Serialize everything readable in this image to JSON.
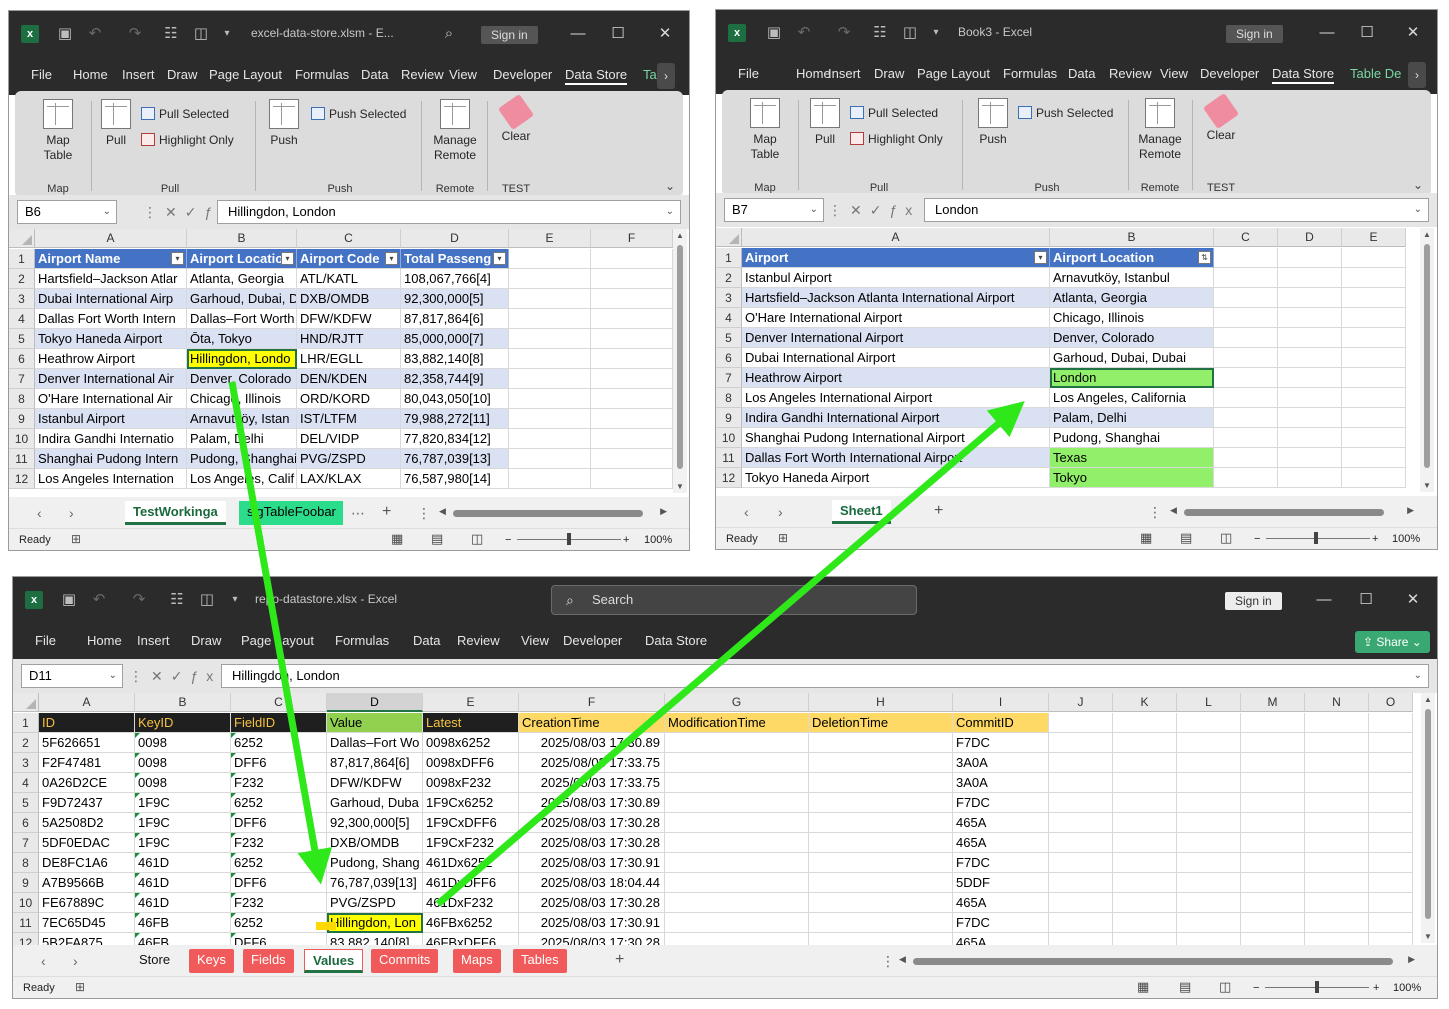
{
  "win1": {
    "title": "excel-data-store.xlsm  -  E...",
    "signin": "Sign in",
    "menus": [
      "File",
      "Home",
      "Insert",
      "Draw",
      "Page Layout",
      "Formulas",
      "Data",
      "Review",
      "View",
      "Developer",
      "Data Store",
      "Ta"
    ],
    "namebox": "B6",
    "formula": "Hillingdon, London",
    "cols": [
      "A",
      "B",
      "C",
      "D",
      "E",
      "F"
    ],
    "rows": [
      "1",
      "2",
      "3",
      "4",
      "5",
      "6",
      "7",
      "8",
      "9",
      "10",
      "11",
      "12"
    ],
    "header": [
      "Airport Name",
      "Airport Locatio",
      "Airport Code",
      "Total Passeng"
    ],
    "data": [
      [
        "Hartsfield–Jackson Atlar",
        "Atlanta, Georgia",
        "ATL/KATL",
        "108,067,766[4]"
      ],
      [
        "Dubai International Airp",
        "Garhoud, Dubai, D",
        "DXB/OMDB",
        "92,300,000[5]"
      ],
      [
        "Dallas Fort Worth Intern",
        "Dallas–Fort Worth",
        "DFW/KDFW",
        "87,817,864[6]"
      ],
      [
        "Tokyo Haneda Airport",
        "Ōta, Tokyo",
        "HND/RJTT",
        "85,000,000[7]"
      ],
      [
        "Heathrow Airport",
        "Hillingdon, Londo",
        "LHR/EGLL",
        "83,882,140[8]"
      ],
      [
        "Denver International Air",
        "Denver, Colorado",
        "DEN/KDEN",
        "82,358,744[9]"
      ],
      [
        "O'Hare International Air",
        "Chicago, Illinois",
        "ORD/KORD",
        "80,043,050[10]"
      ],
      [
        "Istanbul Airport",
        "Arnavutköy, Istan",
        "IST/LTFM",
        "79,988,272[11]"
      ],
      [
        "Indira Gandhi Internatio",
        "Palam, Delhi",
        "DEL/VIDP",
        "77,820,834[12]"
      ],
      [
        "Shanghai Pudong Intern",
        "Pudong, Shanghai",
        "PVG/ZSPD",
        "76,787,039[13]"
      ],
      [
        "Los Angeles Internation",
        "Los Angeles, Calif",
        "LAX/KLAX",
        "76,587,980[14]"
      ]
    ],
    "tabs": [
      "TestWorkinga",
      "sigTableFoobar"
    ],
    "status": "Ready",
    "zoom": "100%"
  },
  "win2": {
    "title": "Book3  -  Excel",
    "signin": "Sign in",
    "menus": [
      "File",
      "Home",
      "Insert",
      "Draw",
      "Page Layout",
      "Formulas",
      "Data",
      "Review",
      "View",
      "Developer",
      "Data Store",
      "Table De"
    ],
    "namebox": "B7",
    "formula": "London",
    "cols": [
      "A",
      "B",
      "C",
      "D",
      "E"
    ],
    "rows": [
      "1",
      "2",
      "3",
      "4",
      "5",
      "6",
      "7",
      "8",
      "9",
      "10",
      "11",
      "12"
    ],
    "header": [
      "Airport",
      "Airport Location"
    ],
    "data": [
      [
        "Istanbul Airport",
        "Arnavutköy, Istanbul"
      ],
      [
        "Hartsfield–Jackson Atlanta International Airport",
        "Atlanta, Georgia"
      ],
      [
        "O'Hare International Airport",
        "Chicago, Illinois"
      ],
      [
        "Denver International Airport",
        "Denver, Colorado"
      ],
      [
        "Dubai International Airport",
        "Garhoud, Dubai, Dubai"
      ],
      [
        "Heathrow Airport",
        "London"
      ],
      [
        "Los Angeles International Airport",
        "Los Angeles, California"
      ],
      [
        "Indira Gandhi International Airport",
        "Palam, Delhi"
      ],
      [
        "Shanghai Pudong International Airport",
        "Pudong, Shanghai"
      ],
      [
        "Dallas Fort Worth International Airport",
        "Texas"
      ],
      [
        "Tokyo Haneda Airport",
        "Tokyo"
      ]
    ],
    "tabs": [
      "Sheet1"
    ],
    "status": "Ready",
    "zoom": "100%"
  },
  "ribbon": {
    "map_table": "Map Table",
    "pull": "Pull",
    "pull_selected": "Pull Selected",
    "highlight_only": "Highlight Only",
    "push": "Push",
    "push_selected": "Push Selected",
    "manage_remote": "Manage Remote",
    "clear": "Clear",
    "groups": [
      "Map",
      "Pull",
      "Push",
      "Remote",
      "TEST"
    ]
  },
  "win3": {
    "title": "repo-datastore.xlsx  -  Excel",
    "search": "Search",
    "signin": "Sign in",
    "share": "Share",
    "menus": [
      "File",
      "Home",
      "Insert",
      "Draw",
      "Page Layout",
      "Formulas",
      "Data",
      "Review",
      "View",
      "Developer",
      "Data Store"
    ],
    "namebox": "D11",
    "formula": "Hillingdon, London",
    "cols": [
      "A",
      "B",
      "C",
      "D",
      "E",
      "F",
      "G",
      "H",
      "I",
      "J",
      "K",
      "L",
      "M",
      "N",
      "O"
    ],
    "rows": [
      "1",
      "2",
      "3",
      "4",
      "5",
      "6",
      "7",
      "8",
      "9",
      "10",
      "11",
      "12"
    ],
    "header": [
      "ID",
      "KeyID",
      "FieldID",
      "Value",
      "Latest",
      "CreationTime",
      "ModificationTime",
      "DeletionTime",
      "CommitID"
    ],
    "data": [
      [
        "5F626651",
        "0098",
        "6252",
        "Dallas–Fort Wo",
        "0098x6252",
        "2025/08/03 17:30.89",
        "",
        "",
        "F7DC"
      ],
      [
        "F2F47481",
        "0098",
        "DFF6",
        "87,817,864[6]",
        "0098xDFF6",
        "2025/08/03 17:33.75",
        "",
        "",
        "3A0A"
      ],
      [
        "0A26D2CE",
        "0098",
        "F232",
        "DFW/KDFW",
        "0098xF232",
        "2025/08/03 17:33.75",
        "",
        "",
        "3A0A"
      ],
      [
        "F9D72437",
        "1F9C",
        "6252",
        "Garhoud, Duba",
        "1F9Cx6252",
        "2025/08/03 17:30.89",
        "",
        "",
        "F7DC"
      ],
      [
        "5A2508D2",
        "1F9C",
        "DFF6",
        "92,300,000[5]",
        "1F9CxDFF6",
        "2025/08/03 17:30.28",
        "",
        "",
        "465A"
      ],
      [
        "5DF0EDAC",
        "1F9C",
        "F232",
        "DXB/OMDB",
        "1F9CxF232",
        "2025/08/03 17:30.28",
        "",
        "",
        "465A"
      ],
      [
        "DE8FC1A6",
        "461D",
        "6252",
        "Pudong, Shang",
        "461Dx6252",
        "2025/08/03 17:30.91",
        "",
        "",
        "F7DC"
      ],
      [
        "A7B9566B",
        "461D",
        "DFF6",
        "76,787,039[13]",
        "461DxDFF6",
        "2025/08/03 18:04.44",
        "",
        "",
        "5DDF"
      ],
      [
        "FE67889C",
        "461D",
        "F232",
        "PVG/ZSPD",
        "461DxF232",
        "2025/08/03 17:30.28",
        "",
        "",
        "465A"
      ],
      [
        "7EC65D45",
        "46FB",
        "6252",
        "Hillingdon, Lon",
        "46FBx6252",
        "2025/08/03 17:30.91",
        "",
        "",
        "F7DC"
      ],
      [
        "5B2FA875",
        "46FB",
        "DFF6",
        "83,882,140[8]",
        "46FBxDFF6",
        "2025/08/03 17:30.28",
        "",
        "",
        "465A"
      ]
    ],
    "tabs": [
      "Store",
      "Keys",
      "Fields",
      "Values",
      "Commits",
      "Maps",
      "Tables"
    ],
    "status": "Ready",
    "zoom": "100%"
  },
  "colors": {
    "arrow": "#2ee81a",
    "tableHeader": "#4472c4",
    "band": "#d9e1f2",
    "highlightYellow": "#ffff00",
    "highlightGreen": "#92ef6a"
  }
}
